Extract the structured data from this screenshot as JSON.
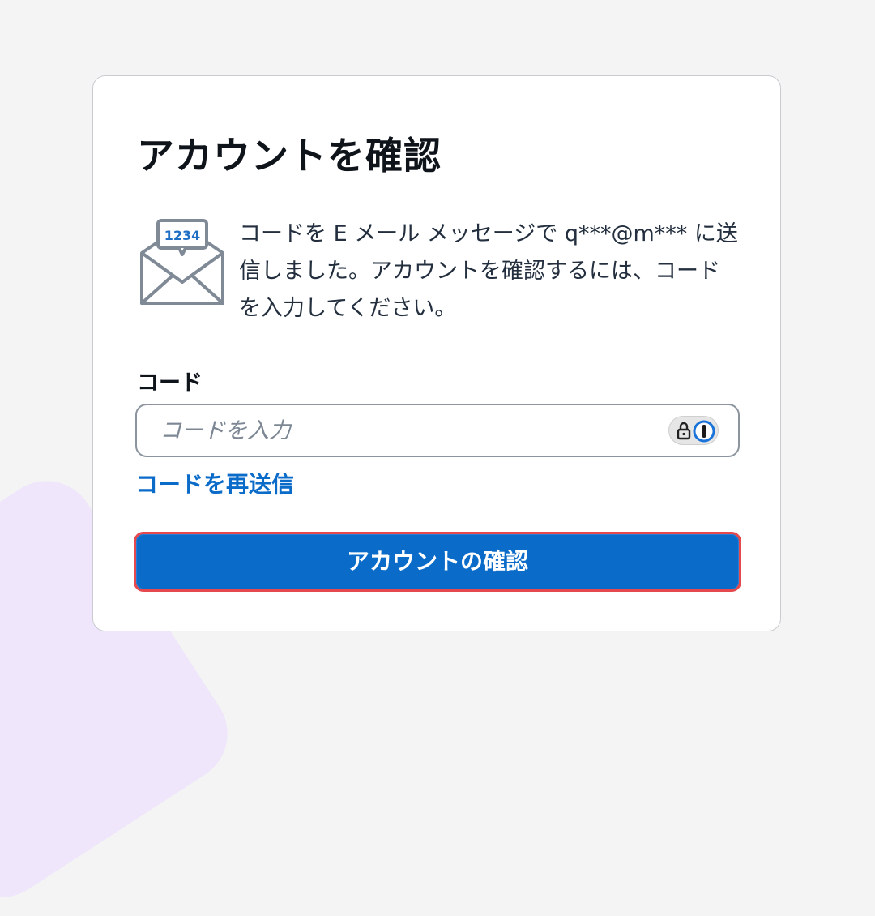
{
  "page": {
    "title": "アカウントを確認",
    "message": "コードを E メール メッセージで q***@m*** に送信しました。アカウントを確認するには、コードを入力してください。",
    "envelope_code": "1234"
  },
  "form": {
    "code_label": "コード",
    "code_placeholder": "コードを入力",
    "code_value": "",
    "resend_link": "コードを再送信",
    "submit_label": "アカウントの確認"
  },
  "icons": {
    "envelope": "envelope-with-code-icon",
    "password_manager": "password-manager-lock-icon"
  },
  "colors": {
    "primary": "#0a6bc8",
    "button_outline": "#e5484d",
    "text": "#0f141a",
    "body_text": "#232f3e",
    "input_border": "#8c949e"
  }
}
